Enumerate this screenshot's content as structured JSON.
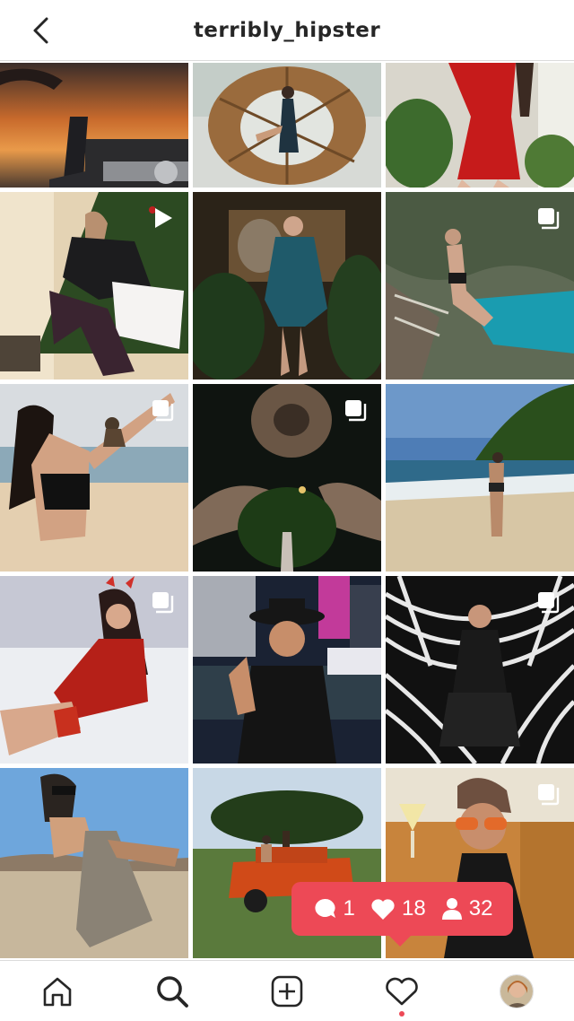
{
  "header": {
    "title": "terribly_hipster"
  },
  "grid": {
    "tiles": [
      {
        "id": "sunset-car",
        "icon": "none"
      },
      {
        "id": "nest-chair",
        "icon": "none"
      },
      {
        "id": "red-dress",
        "icon": "none"
      },
      {
        "id": "christmas-tree",
        "icon": "video-icon"
      },
      {
        "id": "blue-suit",
        "icon": "none"
      },
      {
        "id": "cenote",
        "icon": "multiple-posts-icon"
      },
      {
        "id": "monkey-beach",
        "icon": "multiple-posts-icon"
      },
      {
        "id": "night-statue",
        "icon": "multiple-posts-icon"
      },
      {
        "id": "tropical-beach",
        "icon": "none"
      },
      {
        "id": "red-lingerie",
        "icon": "multiple-posts-icon"
      },
      {
        "id": "city-hat",
        "icon": "none"
      },
      {
        "id": "striped-room",
        "icon": "multiple-posts-icon"
      },
      {
        "id": "desert-boots",
        "icon": "none"
      },
      {
        "id": "jeep-tree",
        "icon": "none"
      },
      {
        "id": "cocktail-glasses",
        "icon": "multiple-posts-icon"
      }
    ]
  },
  "activity": {
    "comments": "1",
    "likes": "18",
    "follows": "32",
    "color": "#ed4956"
  },
  "tabbar": {
    "items": [
      "home-icon",
      "search-icon",
      "new-post-icon",
      "activity-heart-icon",
      "profile-avatar"
    ]
  }
}
